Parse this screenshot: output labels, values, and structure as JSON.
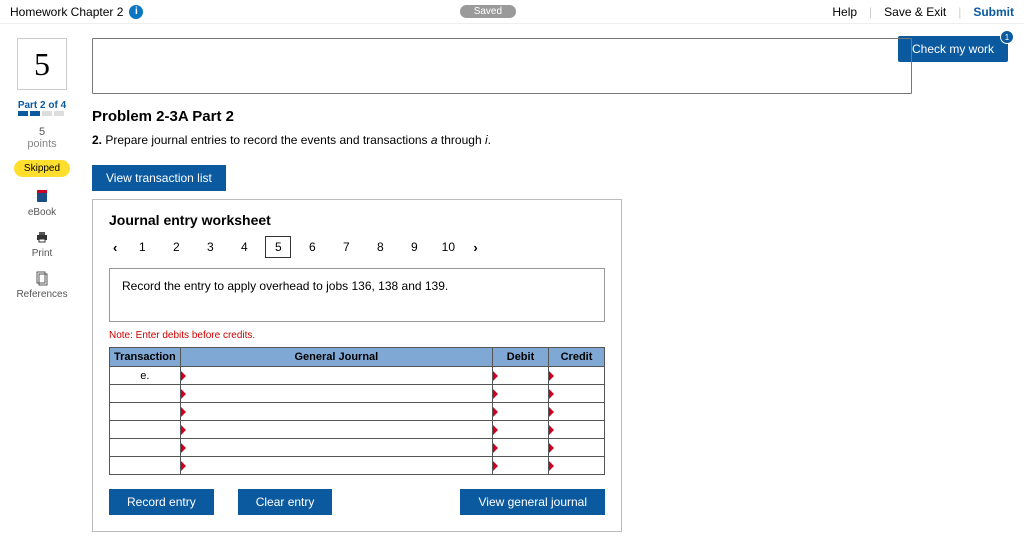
{
  "topbar": {
    "title": "Homework Chapter 2",
    "info_icon": "i",
    "saved": "Saved",
    "help": "Help",
    "save_exit": "Save & Exit",
    "submit": "Submit"
  },
  "check_my_work": {
    "label": "Check my work",
    "badge": "1"
  },
  "left": {
    "question_number": "5",
    "part_label": "Part 2 of 4",
    "points_value": "5",
    "points_label": "points",
    "skipped": "Skipped",
    "ebook": "eBook",
    "print": "Print",
    "references": "References"
  },
  "problem": {
    "title": "Problem 2-3A Part 2",
    "instruction_prefix": "2.",
    "instruction_text_a": "Prepare journal entries to record the events and transactions ",
    "instruction_italic_a": "a",
    "instruction_text_b": " through ",
    "instruction_italic_b": "i",
    "instruction_text_c": "."
  },
  "view_transaction_list": "View transaction list",
  "worksheet": {
    "title": "Journal entry worksheet",
    "steps": [
      "1",
      "2",
      "3",
      "4",
      "5",
      "6",
      "7",
      "8",
      "9",
      "10"
    ],
    "active_step_index": 4,
    "prompt": "Record the entry to apply overhead to jobs 136, 138 and 139.",
    "note": "Note: Enter debits before credits.",
    "headers": {
      "transaction": "Transaction",
      "general_journal": "General Journal",
      "debit": "Debit",
      "credit": "Credit"
    },
    "rows": [
      {
        "transaction": "e.",
        "gj": "",
        "debit": "",
        "credit": ""
      },
      {
        "transaction": "",
        "gj": "",
        "debit": "",
        "credit": ""
      },
      {
        "transaction": "",
        "gj": "",
        "debit": "",
        "credit": ""
      },
      {
        "transaction": "",
        "gj": "",
        "debit": "",
        "credit": ""
      },
      {
        "transaction": "",
        "gj": "",
        "debit": "",
        "credit": ""
      },
      {
        "transaction": "",
        "gj": "",
        "debit": "",
        "credit": ""
      }
    ],
    "record_entry": "Record entry",
    "clear_entry": "Clear entry",
    "view_general_journal": "View general journal"
  }
}
